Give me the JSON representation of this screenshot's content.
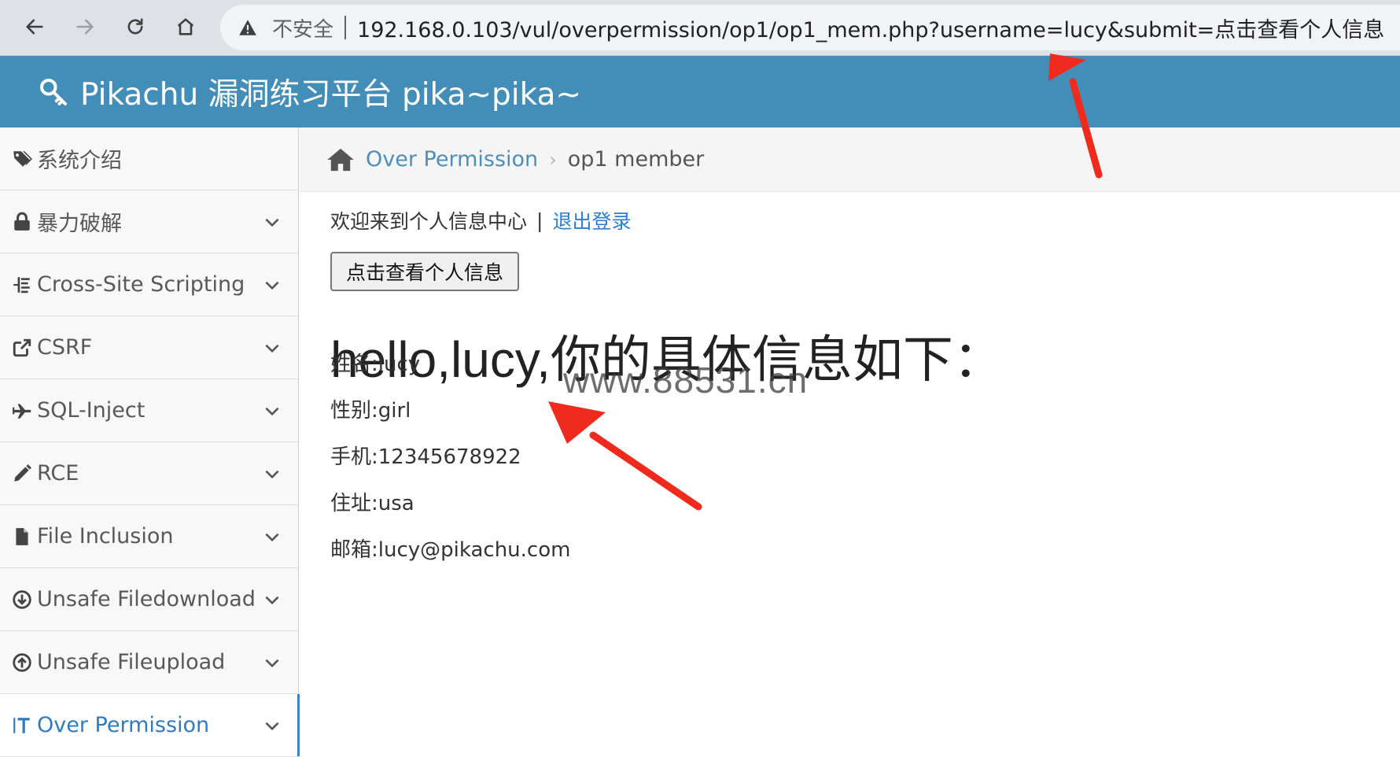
{
  "browser": {
    "back_icon": "arrow-left-icon",
    "forward_icon": "arrow-right-icon",
    "reload_icon": "reload-icon",
    "home_icon": "home-icon",
    "security_label": "不安全",
    "url": "192.168.0.103/vul/overpermission/op1/op1_mem.php?username=lucy&submit=点击查看个人信息"
  },
  "header": {
    "title": "Pikachu 漏洞练习平台 pika~pika~"
  },
  "sidebar": {
    "items": [
      {
        "label": "系统介绍",
        "icon": "tags-icon",
        "expandable": false
      },
      {
        "label": "暴力破解",
        "icon": "lock-icon",
        "expandable": true
      },
      {
        "label": "Cross-Site Scripting",
        "icon": "list-icon",
        "expandable": true
      },
      {
        "label": "CSRF",
        "icon": "share-icon",
        "expandable": true
      },
      {
        "label": "SQL-Inject",
        "icon": "plane-icon",
        "expandable": true
      },
      {
        "label": "RCE",
        "icon": "pencil-icon",
        "expandable": true
      },
      {
        "label": "File Inclusion",
        "icon": "file-icon",
        "expandable": true
      },
      {
        "label": "Unsafe Filedownload",
        "icon": "download-circle-icon",
        "expandable": true
      },
      {
        "label": "Unsafe Fileupload",
        "icon": "upload-circle-icon",
        "expandable": true
      },
      {
        "label": "Over Permission",
        "icon": "text-cursor-icon",
        "expandable": true,
        "active": true
      }
    ]
  },
  "breadcrumb": {
    "parent": "Over Permission",
    "current": "op1 member"
  },
  "main": {
    "welcome_text": "欢迎来到个人信息中心",
    "separator": "|",
    "logout_link": "退出登录",
    "view_button": "点击查看个人信息",
    "heading": "hello,lucy,你的具体信息如下：",
    "watermark": "www.88531.cn",
    "info": [
      "姓名:lucy",
      "性别:girl",
      "手机:12345678922",
      "住址:usa",
      "邮箱:lucy@pikachu.com"
    ]
  },
  "colors": {
    "header_bg": "#438eb9",
    "link": "#4c8fbd",
    "annotation_arrow": "#f02b1d"
  }
}
